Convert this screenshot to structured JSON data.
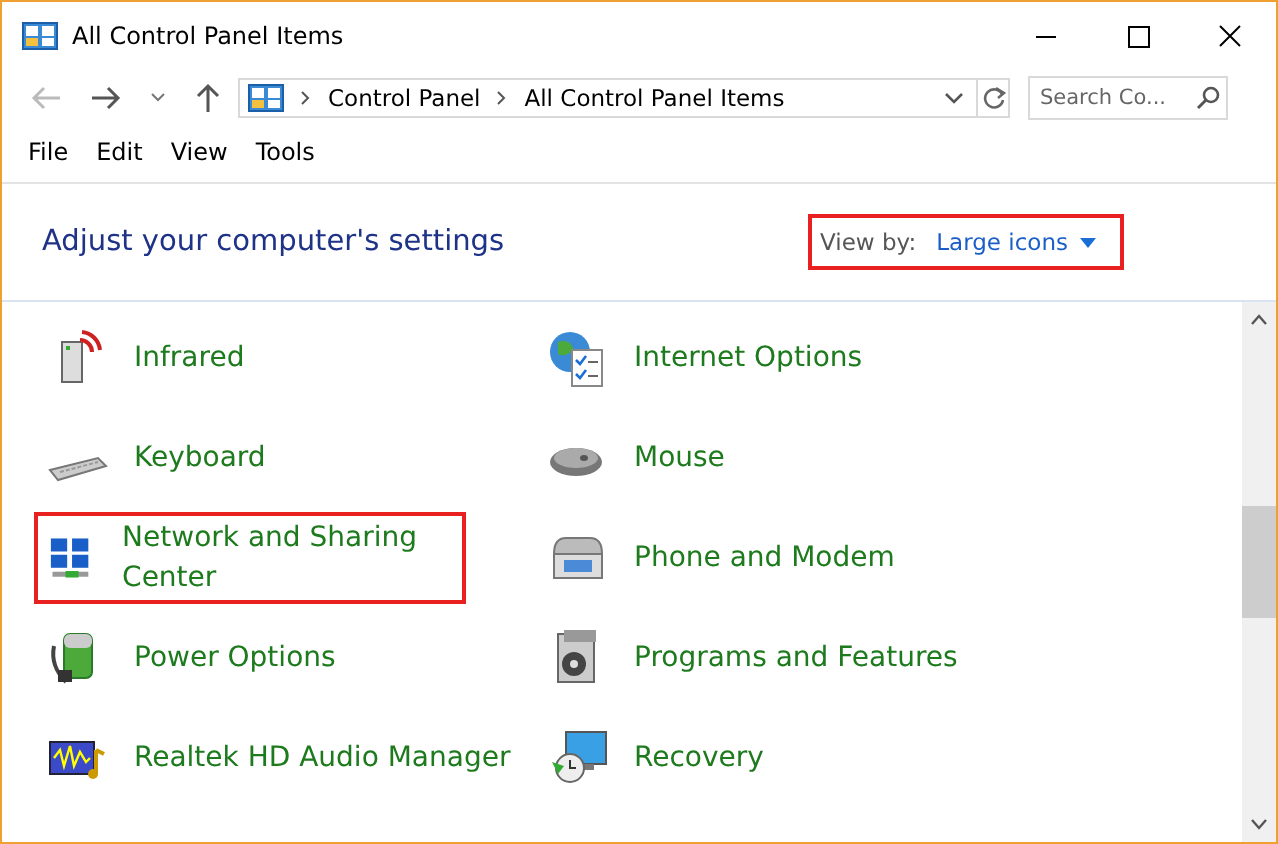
{
  "window": {
    "title": "All Control Panel Items"
  },
  "address_bar": {
    "path": [
      "Control Panel",
      "All Control Panel Items"
    ],
    "search_placeholder": "Search Co..."
  },
  "menu": [
    "File",
    "Edit",
    "View",
    "Tools"
  ],
  "header": {
    "title": "Adjust your computer's settings",
    "view_by_label": "View by:",
    "view_by_value": "Large icons",
    "highlighted": true
  },
  "items": [
    {
      "label": "Infrared",
      "highlighted": false
    },
    {
      "label": "Internet Options",
      "highlighted": false
    },
    {
      "label": "Keyboard",
      "highlighted": false
    },
    {
      "label": "Mouse",
      "highlighted": false
    },
    {
      "label": "Network and Sharing Center",
      "highlighted": true
    },
    {
      "label": "Phone and Modem",
      "highlighted": false
    },
    {
      "label": "Power Options",
      "highlighted": false
    },
    {
      "label": "Programs and Features",
      "highlighted": false
    },
    {
      "label": "Realtek HD Audio Manager",
      "highlighted": false
    },
    {
      "label": "Recovery",
      "highlighted": false
    }
  ]
}
